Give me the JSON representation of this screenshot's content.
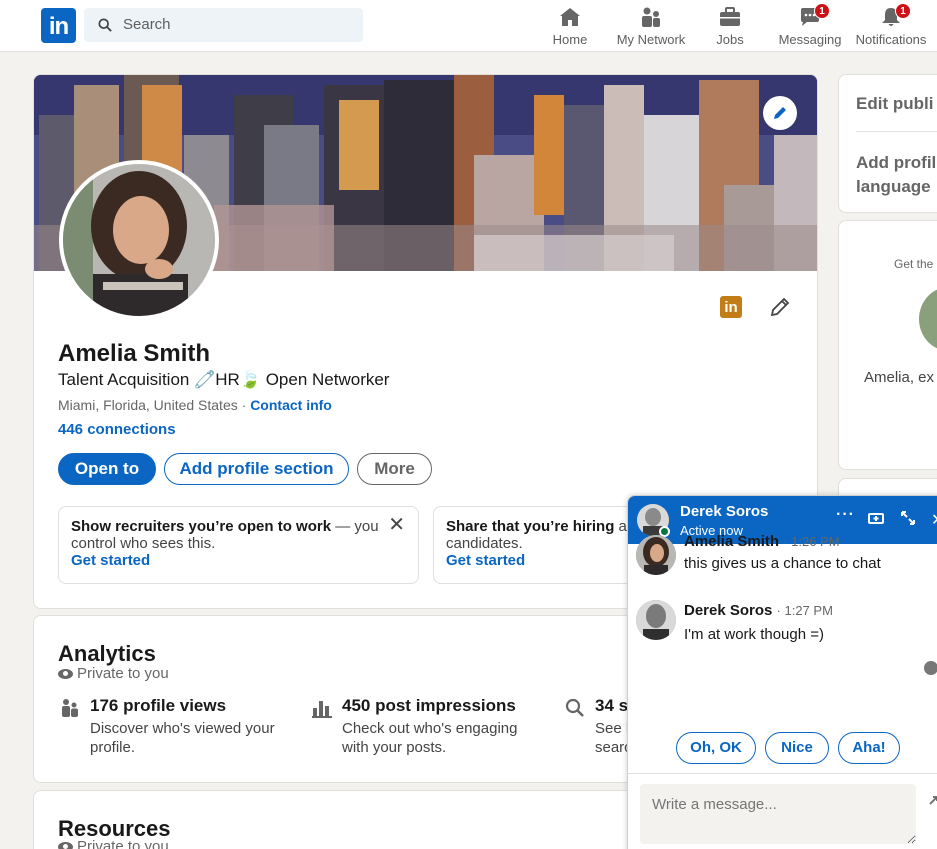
{
  "nav": {
    "search_placeholder": "Search",
    "items": [
      {
        "label": "Home",
        "icon": "home-icon"
      },
      {
        "label": "My Network",
        "icon": "network-icon"
      },
      {
        "label": "Jobs",
        "icon": "briefcase-icon"
      },
      {
        "label": "Messaging",
        "icon": "messaging-icon",
        "badge": "1"
      },
      {
        "label": "Notifications",
        "icon": "bell-icon",
        "badge": "1"
      }
    ]
  },
  "profile": {
    "name": "Amelia Smith",
    "headline": "Talent Acquisition 🧷HR🍃 Open Networker",
    "location": "Miami, Florida, United States ·",
    "contact_info": "Contact info",
    "connections": "446 connections",
    "buttons": {
      "open_to": "Open to",
      "add_section": "Add profile section",
      "more": "More"
    },
    "promo_work": {
      "bold": "Show recruiters you’re open to work",
      "rest": " — you control who sees this.",
      "link": "Get started"
    },
    "promo_hiring": {
      "bold": "Share that you’re hiring",
      "rest": " and attract qualified candidates.",
      "link": "Get started"
    }
  },
  "analytics": {
    "title": "Analytics",
    "privacy": "Private to you",
    "stats": [
      {
        "title": "176 profile views",
        "desc1": "Discover who's viewed your",
        "desc2": "profile.",
        "icon": "people-icon"
      },
      {
        "title": "450 post impressions",
        "desc1": "Check out who's engaging",
        "desc2": "with your posts.",
        "icon": "bar-chart-icon"
      },
      {
        "title": "34 s",
        "desc1": "See h",
        "desc2": "searc",
        "icon": "search-icon"
      }
    ]
  },
  "resources": {
    "title": "Resources",
    "privacy": "Private to you"
  },
  "right_column": {
    "edit_public": "Edit publi",
    "add_profile_1": "Add profil",
    "add_profile_2": "language",
    "get_the": "Get the",
    "amelia_ex": "Amelia, ex"
  },
  "chat": {
    "contact_name": "Derek Soros",
    "status": "Active now",
    "messages": [
      {
        "sender": "Amelia Smith",
        "time": "· 1:26 PM",
        "text": "this gives us a chance to chat"
      },
      {
        "sender": "Derek Soros",
        "time": "· 1:27 PM",
        "text": "I'm at work though =)"
      }
    ],
    "quick_replies": [
      "Oh, OK",
      "Nice",
      "Aha!"
    ],
    "composer_placeholder": "Write a message..."
  },
  "colors": {
    "brand": "#0a66c2",
    "badge": "#cc1016",
    "online": "#057642"
  }
}
